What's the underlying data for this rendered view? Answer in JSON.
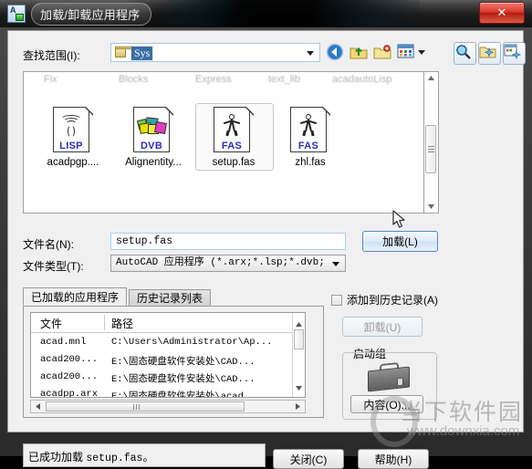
{
  "window": {
    "title": "加载/卸载应用程序",
    "app_icon": "autocad-app-icon",
    "close_glyph": "✕"
  },
  "browser": {
    "lookin_label": "查找范围(I):",
    "lookin_value": "Sys",
    "lookin_icon": "folder-icon",
    "dropdown_arrow": "▼",
    "toolbar": [
      {
        "name": "back-icon",
        "glyph": "◀"
      },
      {
        "name": "up-folder-icon",
        "glyph": "↑"
      },
      {
        "name": "new-folder-icon",
        "glyph": "+"
      },
      {
        "name": "views-icon",
        "glyph": "▦"
      },
      {
        "name": "views-dropdown-arrow",
        "glyph": "▼"
      }
    ],
    "toolbar_right": [
      {
        "name": "search-icon",
        "glyph": "🔍"
      },
      {
        "name": "preview-icon",
        "glyph": "✳"
      },
      {
        "name": "add-favorite-icon",
        "glyph": "▣"
      }
    ],
    "ghost_row": [
      "Fix",
      "Blocks",
      "Express",
      "text_lib",
      "acadautoLisp"
    ],
    "files": [
      {
        "name": "acadpgp....",
        "tag": "LISP",
        "icon": "lisp-file-icon",
        "selected": false
      },
      {
        "name": "Alignentity...",
        "tag": "DVB",
        "icon": "dvb-file-icon",
        "selected": false
      },
      {
        "name": "setup.fas",
        "tag": "FAS",
        "icon": "fas-file-icon",
        "selected": true
      },
      {
        "name": "zhl.fas",
        "tag": "FAS",
        "icon": "fas-file-icon",
        "selected": false
      }
    ],
    "scrollbar": {
      "up": "▲",
      "down": "▼"
    }
  },
  "form": {
    "filename_label": "文件名(N):",
    "filename_value": "setup.fas",
    "filetype_label": "文件类型(T):",
    "filetype_value": "AutoCAD 应用程序 (*.arx;*.lsp;*.dvb;",
    "load_button": "加载(L)"
  },
  "tabs": [
    {
      "label": "已加载的应用程序",
      "active": true
    },
    {
      "label": "历史记录列表",
      "active": false
    }
  ],
  "grid": {
    "columns": [
      "文件",
      "路径"
    ],
    "rows": [
      {
        "file": "acad.mnl",
        "path": "C:\\Users\\Administrator\\Ap..."
      },
      {
        "file": "acad200...",
        "path": "E:\\固态硬盘软件安装处\\CAD..."
      },
      {
        "file": "acad200...",
        "path": "E:\\固态硬盘软件安装处\\CAD..."
      },
      {
        "file": "acadpp.arx",
        "path": "E:\\固态硬盘软件安装处\\acad"
      }
    ]
  },
  "rightpanel": {
    "history_checkbox_label": "添加到历史记录(A)",
    "history_checked": false,
    "unload_button": "卸载(U)",
    "unload_enabled": false,
    "startup_group_label": "启动组",
    "briefcase_icon": "briefcase-icon",
    "content_button": "内容(O)..."
  },
  "bottom": {
    "status_prefix": "已成功加载 ",
    "status_file": "setup.fas",
    "status_suffix": "。",
    "close_button": "关闭(C)",
    "help_button": "帮助(H)"
  },
  "watermark": {
    "brand": "当下软件园",
    "url": "www.downxia.com"
  }
}
